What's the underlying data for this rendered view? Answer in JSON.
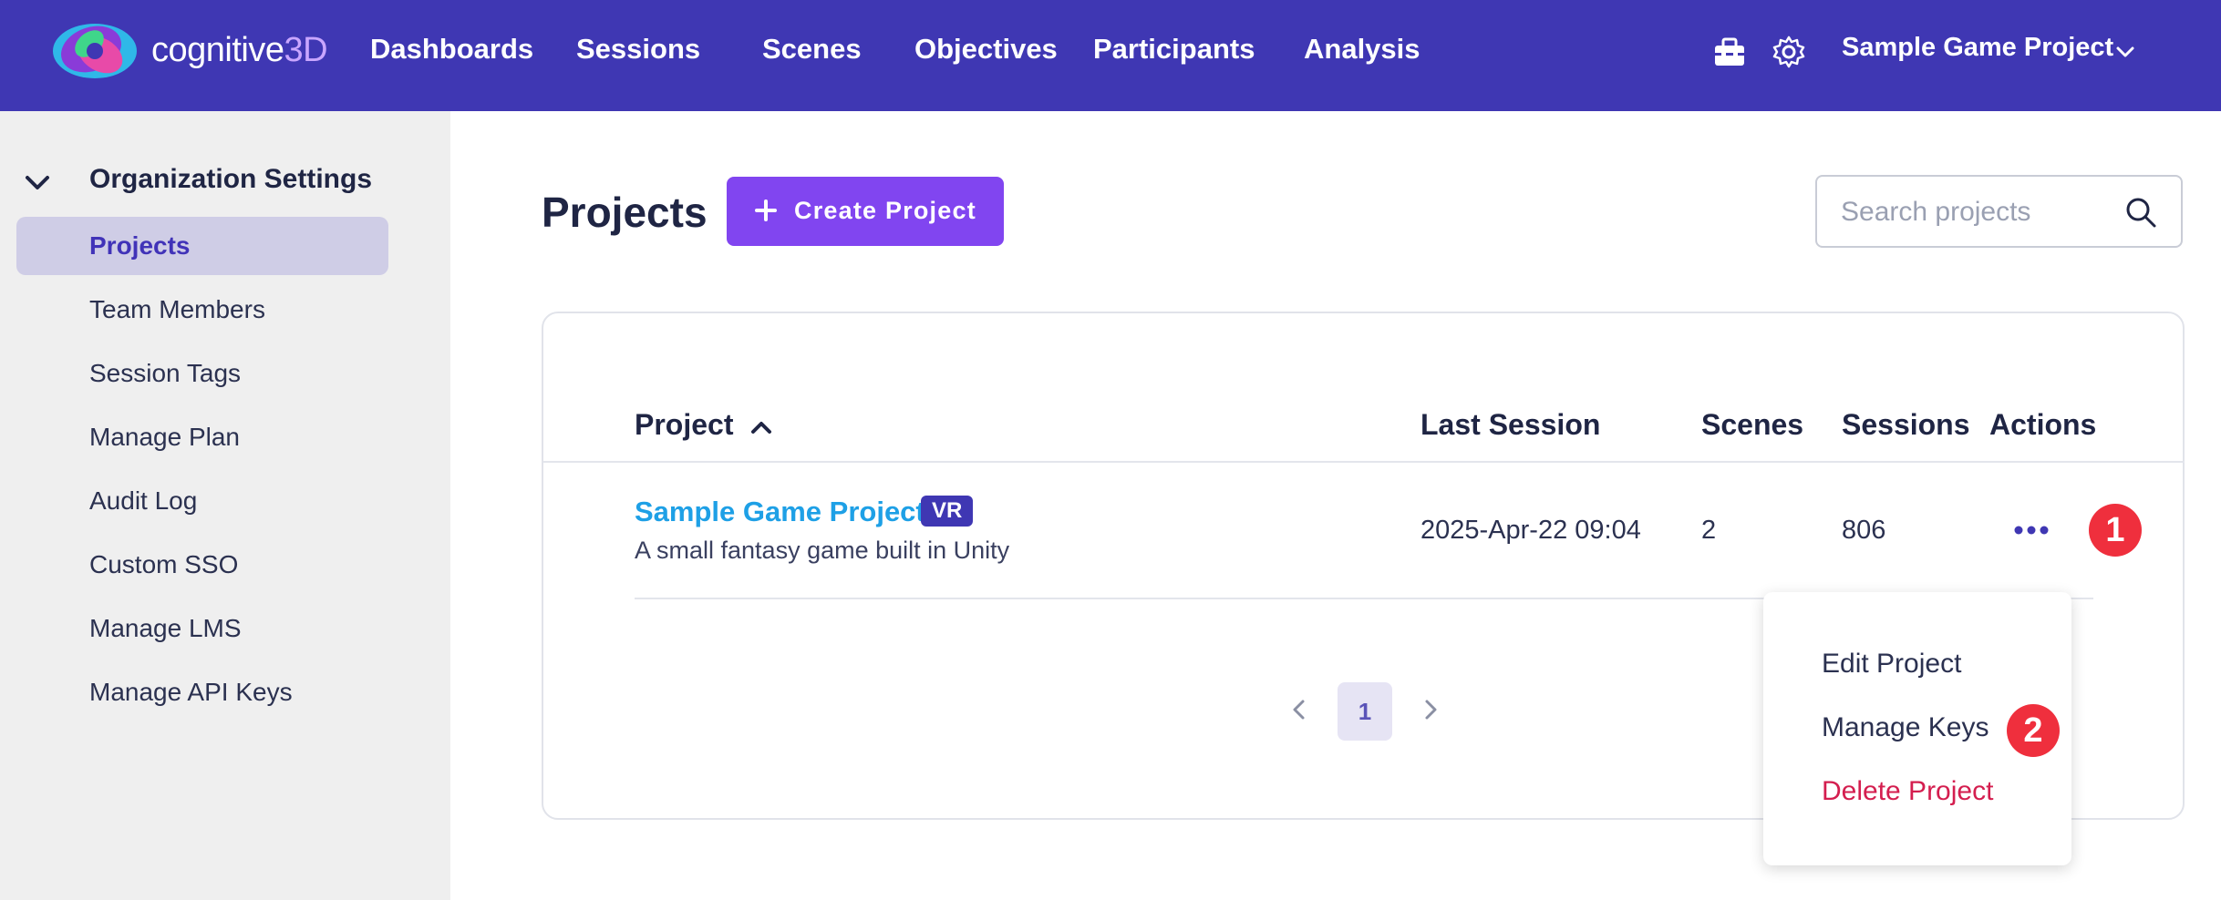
{
  "brand": {
    "name_part1": "cognitive",
    "name_part2": "3D",
    "logo_icon": "swirl-logo-icon"
  },
  "nav": {
    "items": [
      {
        "label": "Dashboards"
      },
      {
        "label": "Sessions"
      },
      {
        "label": "Scenes"
      },
      {
        "label": "Objectives"
      },
      {
        "label": "Participants"
      },
      {
        "label": "Analysis"
      }
    ],
    "toolbox_icon": "toolbox-icon",
    "settings_icon": "gear-icon",
    "project_switcher": "Sample Game Project"
  },
  "sidebar": {
    "heading": "Organization Settings",
    "items": [
      {
        "label": "Projects",
        "active": true
      },
      {
        "label": "Team Members"
      },
      {
        "label": "Session Tags"
      },
      {
        "label": "Manage Plan"
      },
      {
        "label": "Audit Log"
      },
      {
        "label": "Custom SSO"
      },
      {
        "label": "Manage LMS"
      },
      {
        "label": "Manage API Keys"
      }
    ]
  },
  "main": {
    "title": "Projects",
    "create_button": "Create Project",
    "search_placeholder": "Search projects"
  },
  "table": {
    "headers": {
      "project": "Project",
      "last_session": "Last Session",
      "scenes": "Scenes",
      "sessions": "Sessions",
      "actions": "Actions"
    },
    "rows": [
      {
        "name": "Sample Game Project",
        "badge": "VR",
        "description": "A small fantasy game built in Unity",
        "last_session": "2025-Apr-22 09:04",
        "scenes": "2",
        "sessions": "806"
      }
    ],
    "pagination": {
      "current_page": "1"
    }
  },
  "actions_menu": {
    "items": [
      {
        "label": "Edit Project"
      },
      {
        "label": "Manage Keys"
      },
      {
        "label": "Delete Project"
      }
    ]
  },
  "markers": [
    "1",
    "2"
  ],
  "colors": {
    "topbar": "#3f37b3",
    "primary_button": "#8145f0",
    "link": "#1ea0e6",
    "danger": "#d41e4f",
    "marker": "#ef2f3d"
  }
}
